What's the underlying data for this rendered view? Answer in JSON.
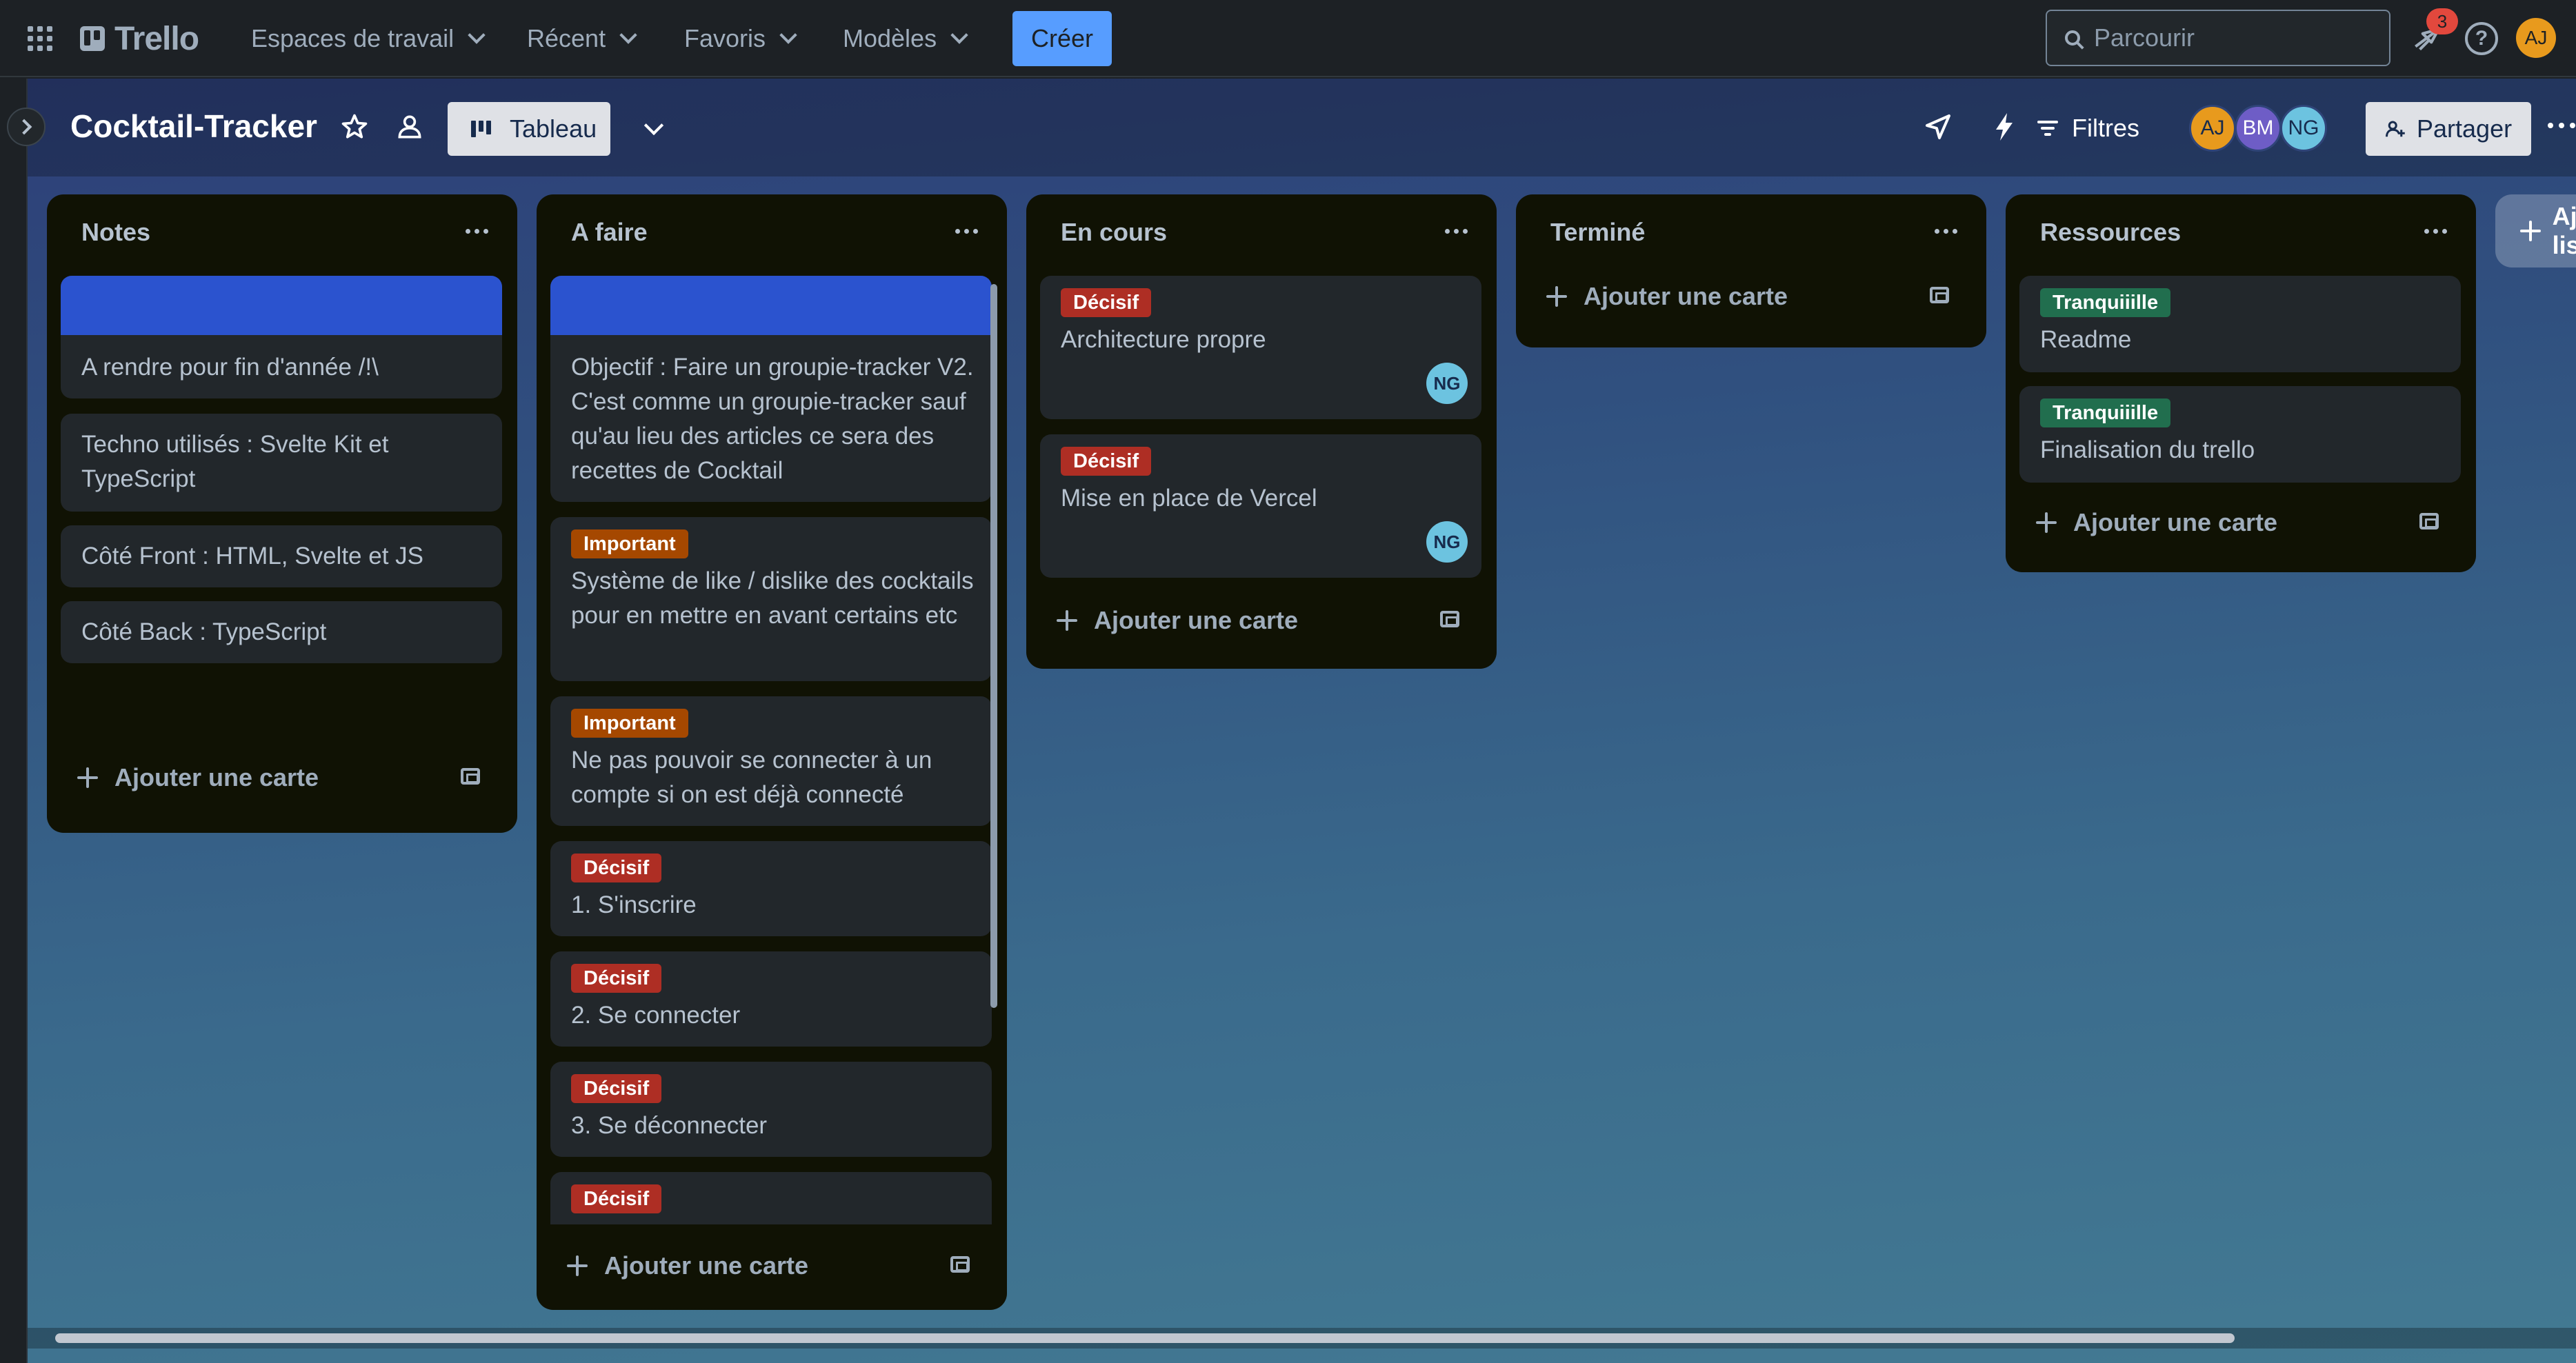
{
  "topnav": {
    "logo": "Trello",
    "menus": [
      "Espaces de travail",
      "Récent",
      "Favoris",
      "Modèles"
    ],
    "create_label": "Créer",
    "search_placeholder": "Parcourir",
    "notification_count": "3",
    "user_initials": "AJ"
  },
  "board": {
    "title": "Cocktail-Tracker",
    "view_label": "Tableau",
    "filters_label": "Filtres",
    "members": [
      {
        "initials": "AJ",
        "color": "#e89a1d"
      },
      {
        "initials": "BM",
        "color": "#6e5dc6"
      },
      {
        "initials": "NG",
        "color": "#6cc3e0"
      }
    ],
    "share_label": "Partager",
    "add_list_label": "Ajouter une autre liste"
  },
  "colors": {
    "cover": "#2b53cf",
    "label_decisif": "#ae2e24",
    "label_important": "#a54800",
    "label_tranquille": "#216e4e"
  },
  "add_card_label": "Ajouter une carte",
  "lists": [
    {
      "title": "Notes",
      "cards": [
        {
          "text": "A rendre pour fin d'année /!\\"
        },
        {
          "text": "Techno utilisés : Svelte Kit et TypeScript"
        },
        {
          "text": "Côté Front : HTML, Svelte et JS"
        },
        {
          "text": "Côté Back : TypeScript"
        }
      ]
    },
    {
      "title": "A faire",
      "cards": [
        {
          "text": "Objectif : Faire un groupie-tracker V2. C'est comme un groupie-tracker sauf qu'au lieu des articles ce sera des recettes de Cocktail"
        },
        {
          "label": "Important",
          "text": "Système de like / dislike des cocktails pour en mettre en avant certains etc"
        },
        {
          "label": "Important",
          "text": "Ne pas pouvoir se connecter à un compte si on est déjà connecté"
        },
        {
          "label": "Décisif",
          "text": "1. S'inscrire"
        },
        {
          "label": "Décisif",
          "text": "2. Se connecter"
        },
        {
          "label": "Décisif",
          "text": "3. Se déconnecter"
        },
        {
          "label": "Décisif",
          "text": ""
        }
      ]
    },
    {
      "title": "En cours",
      "cards": [
        {
          "label": "Décisif",
          "text": "Architecture propre",
          "member": "NG"
        },
        {
          "label": "Décisif",
          "text": "Mise en place de Vercel",
          "member": "NG"
        }
      ]
    },
    {
      "title": "Terminé",
      "cards": []
    },
    {
      "title": "Ressources",
      "cards": [
        {
          "label": "Tranquiiille",
          "text": "Readme"
        },
        {
          "label": "Tranquiiille",
          "text": "Finalisation du trello"
        }
      ]
    }
  ]
}
